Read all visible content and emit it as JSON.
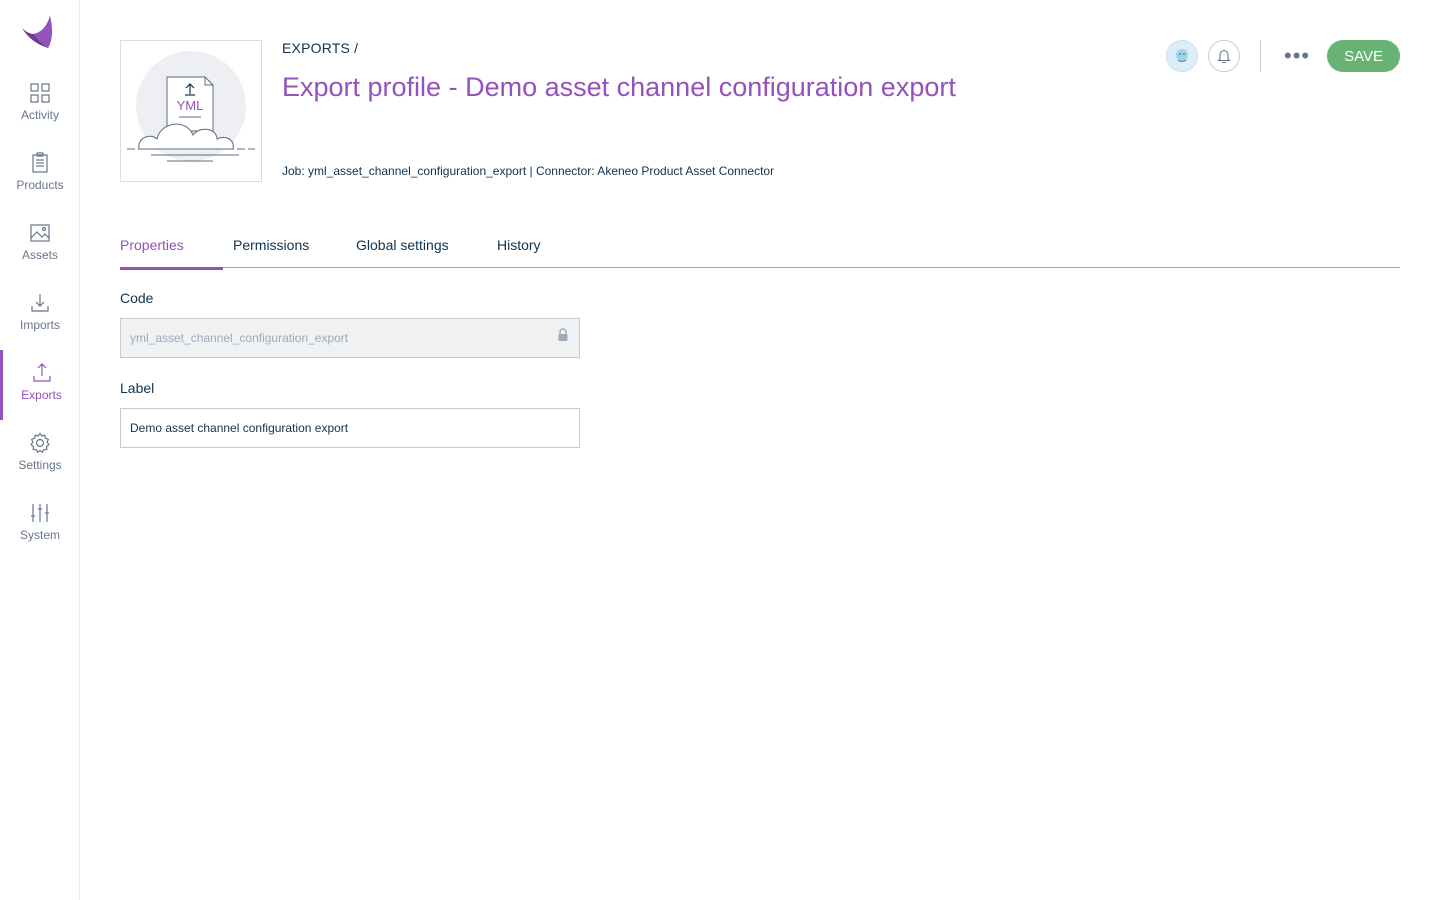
{
  "sidebar": {
    "items": [
      {
        "label": "Activity",
        "icon": "activity-icon"
      },
      {
        "label": "Products",
        "icon": "products-icon"
      },
      {
        "label": "Assets",
        "icon": "assets-icon"
      },
      {
        "label": "Imports",
        "icon": "imports-icon"
      },
      {
        "label": "Exports",
        "icon": "exports-icon",
        "active": true
      },
      {
        "label": "Settings",
        "icon": "settings-icon"
      },
      {
        "label": "System",
        "icon": "system-icon"
      }
    ]
  },
  "header": {
    "breadcrumb": "EXPORTS /",
    "title": "Export profile - Demo asset channel configuration export",
    "meta": "Job: yml_asset_channel_configuration_export | Connector: Akeneo Product Asset Connector",
    "thumbnail_label": "YML",
    "save_label": "SAVE",
    "more_label": "•••"
  },
  "tabs": [
    {
      "label": "Properties",
      "active": true
    },
    {
      "label": "Permissions"
    },
    {
      "label": "Global settings"
    },
    {
      "label": "History"
    }
  ],
  "form": {
    "code_label": "Code",
    "code_value": "yml_asset_channel_configuration_export",
    "label_label": "Label",
    "label_value": "Demo asset channel configuration export"
  },
  "colors": {
    "accent": "#9452ba",
    "save": "#67b373",
    "text": "#11324d"
  }
}
